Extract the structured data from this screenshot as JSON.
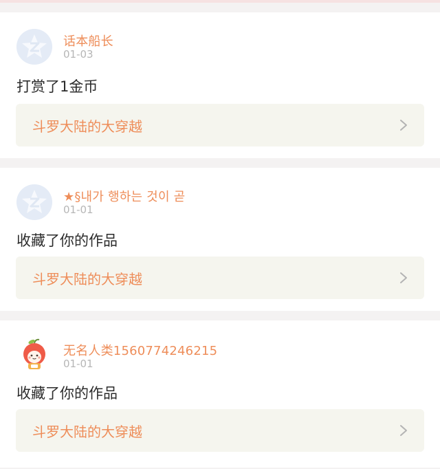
{
  "feed": {
    "items": [
      {
        "username": "话本船长",
        "date": "01-03",
        "action": "打赏了1金币",
        "work_title": "斗罗大陆的大穿越",
        "avatar": "default-q-avatar"
      },
      {
        "username": "★§내가 행하는 것이 곧",
        "date": "01-01",
        "action": "收藏了你的作品",
        "work_title": "斗罗大陆的大穿越",
        "avatar": "default-q-avatar"
      },
      {
        "username": "无名人类1560774246215",
        "date": "01-01",
        "action": "收藏了你的作品",
        "work_title": "斗罗大陆的大穿越",
        "avatar": "apple-character-avatar"
      }
    ]
  },
  "colors": {
    "accent": "#ee8d59",
    "muted": "#b6b6b6",
    "text": "#2b2b2b",
    "link_bg": "#f5f5ee",
    "page_bg": "#f4f2f2"
  },
  "icons": {
    "chevron": "chevron-right-icon"
  }
}
